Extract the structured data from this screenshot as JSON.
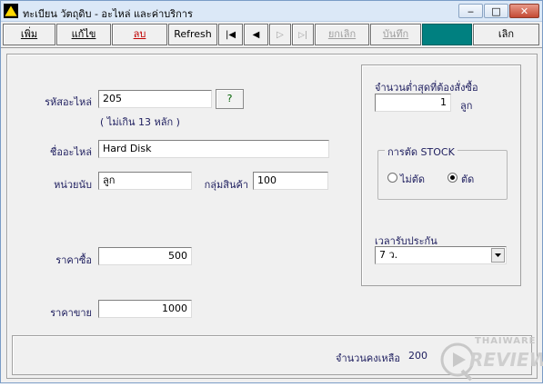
{
  "window": {
    "title": "ทะเบียน วัตถุดิบ  - อะไหล่ และค่าบริการ",
    "min_glyph": "‒",
    "max_glyph": "□",
    "close_glyph": "✕"
  },
  "toolbar": {
    "add": "เพิ่ม",
    "edit": "แก้ไข",
    "delete": "ลบ",
    "refresh": "Refresh",
    "first": "|◀",
    "prev": "◀",
    "next": "▷",
    "last": "▷|",
    "cancel": "ยกเลิก",
    "save": "บันทึก",
    "exit": "เลิก"
  },
  "form": {
    "part_code_label": "รหัสอะไหล่",
    "part_code_value": "205",
    "lookup_button": "?",
    "part_code_hint": "( ไม่เกิน 13 หลัก )",
    "part_name_label": "ชื่ออะไหล่",
    "part_name_value": "Hard Disk",
    "unit_label": "หน่วยนับ",
    "unit_value": "ลูก",
    "group_label": "กลุ่มสินค้า",
    "group_value": "100",
    "buy_price_label": "ราคาซื้อ",
    "buy_price_value": "500",
    "sell_price_label": "ราคาขาย",
    "sell_price_value": "1000"
  },
  "right_panel": {
    "min_order_label": "จำนวนต่ำสุดที่ต้องสั่งซื้อ",
    "min_order_value": "1",
    "min_order_unit": "ลูก",
    "stock_group_title": "การตัด STOCK",
    "stock_option_no": "ไม่ตัด",
    "stock_option_yes": "ตัด",
    "stock_selected": "ตัด",
    "warranty_label": "เวลารับประกัน",
    "warranty_value": "7 ว."
  },
  "footer": {
    "remaining_label": "จำนวนคงเหลือ",
    "remaining_value": "200"
  },
  "watermark": {
    "line1": "THAIWARE",
    "line2": "REVIEW"
  },
  "colors": {
    "teal_button": "#008080",
    "delete_red": "#c00000",
    "label_navy": "#202060"
  }
}
